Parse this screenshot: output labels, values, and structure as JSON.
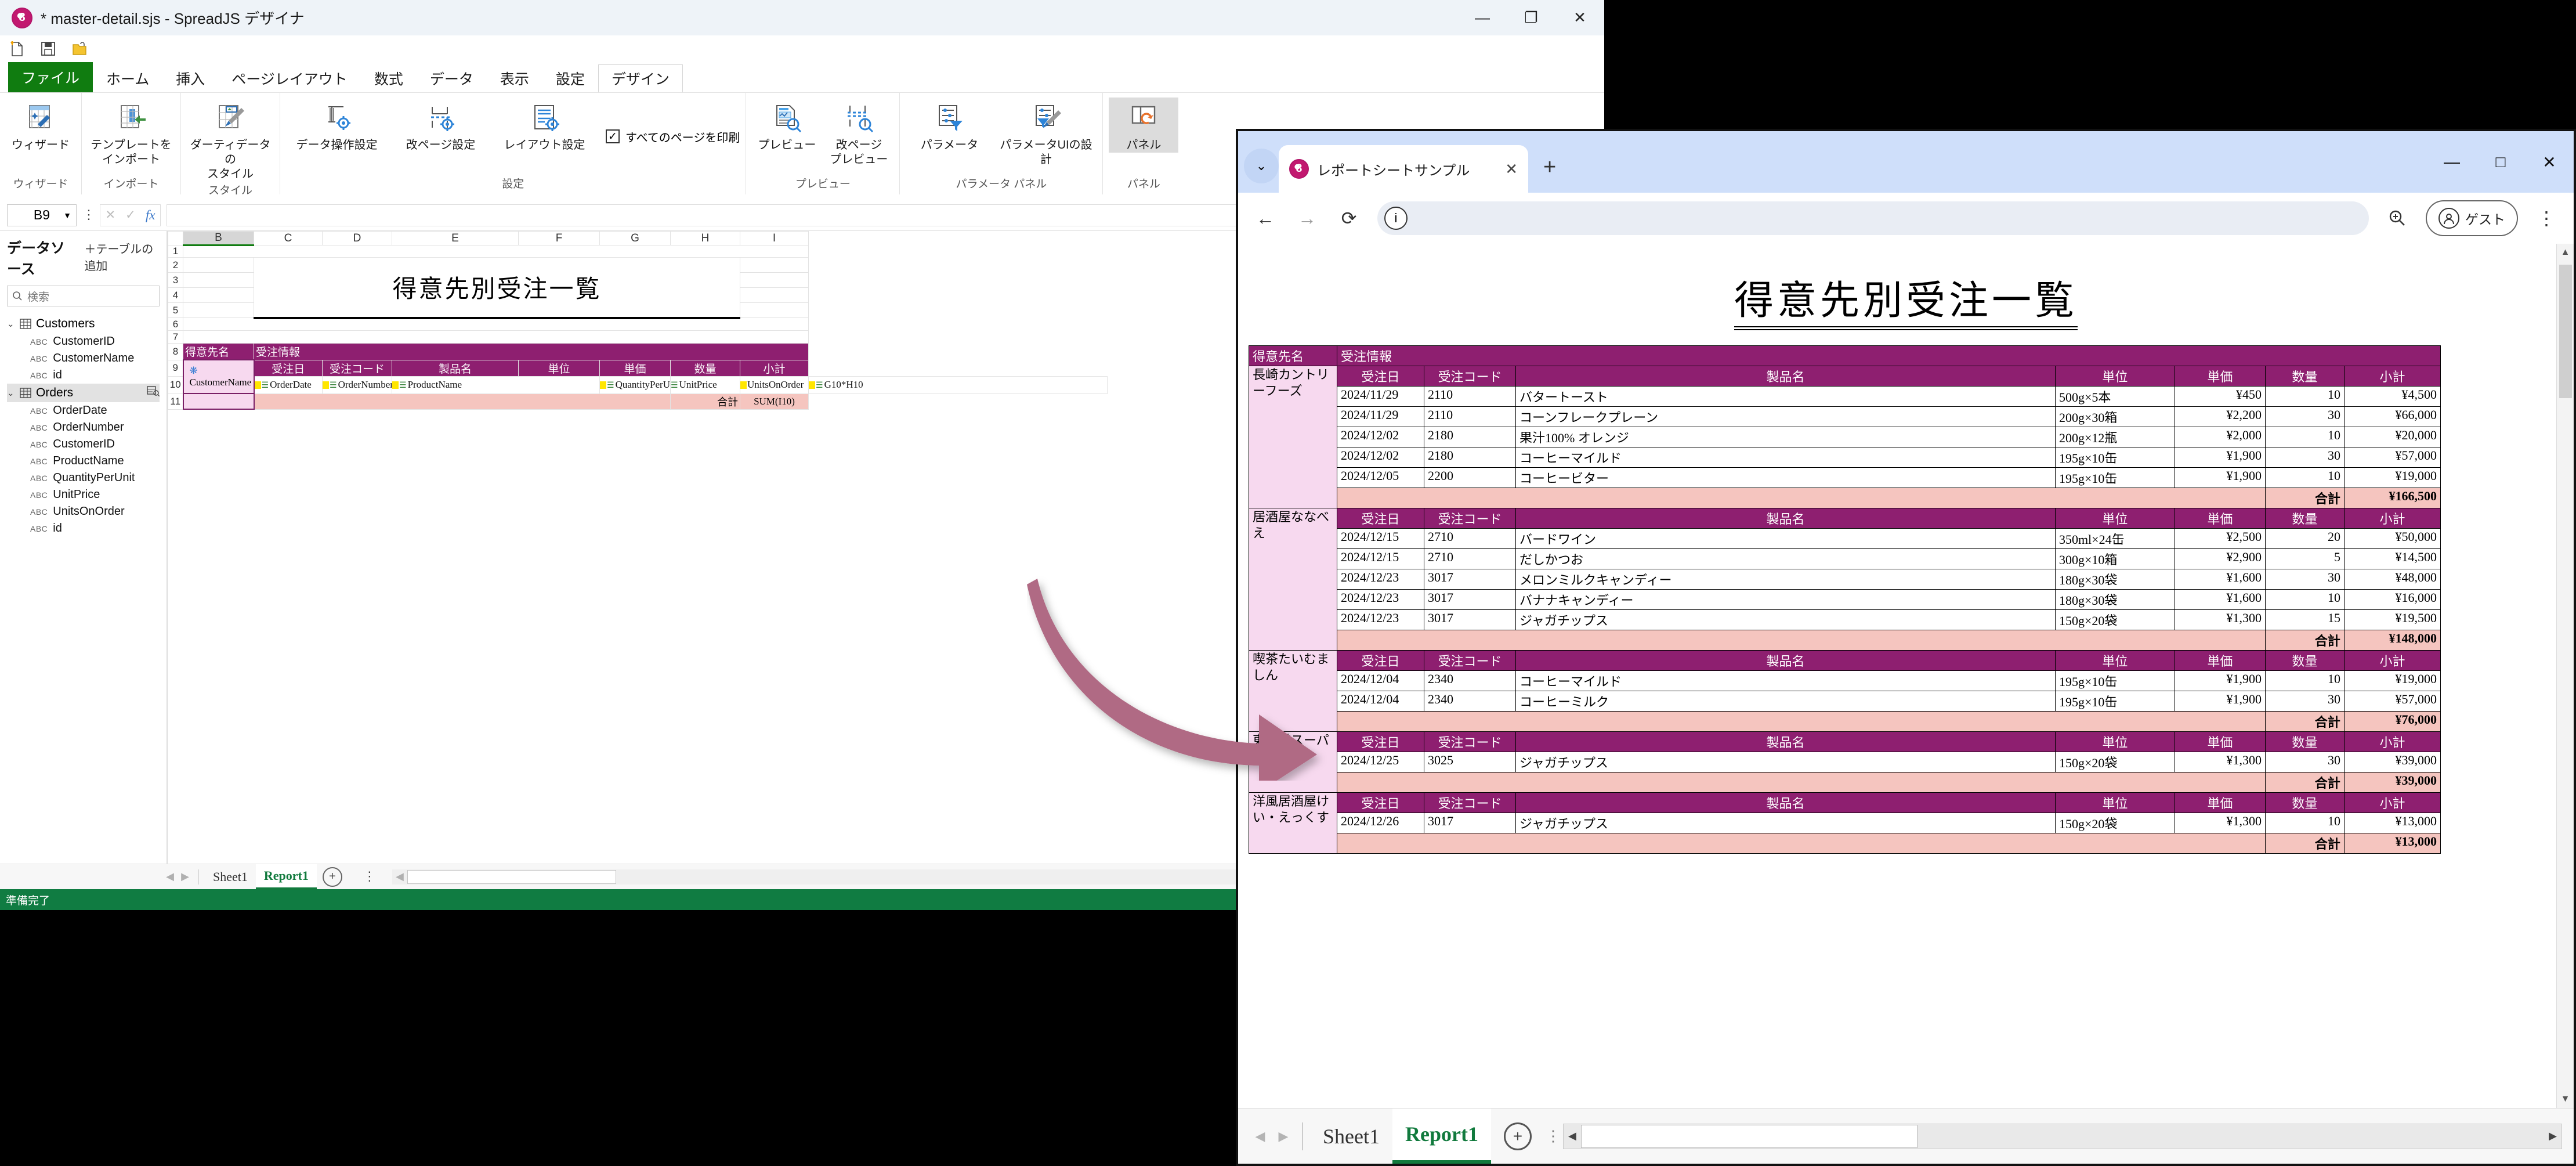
{
  "designer": {
    "title": "* master-detail.sjs - SpreadJS デザイナ",
    "logo_glyph": "8",
    "window_controls": {
      "minimize": "—",
      "maximize": "❐",
      "close": "✕"
    },
    "quick_access": [
      "new-file-icon",
      "save-icon",
      "open-folder-icon"
    ],
    "tabs": [
      {
        "label": "ファイル",
        "kind": "file"
      },
      {
        "label": "ホーム",
        "kind": "normal"
      },
      {
        "label": "挿入",
        "kind": "normal"
      },
      {
        "label": "ページレイアウト",
        "kind": "normal"
      },
      {
        "label": "数式",
        "kind": "normal"
      },
      {
        "label": "データ",
        "kind": "normal"
      },
      {
        "label": "表示",
        "kind": "normal"
      },
      {
        "label": "設定",
        "kind": "normal"
      },
      {
        "label": "デザイン",
        "kind": "active"
      }
    ],
    "ribbon_groups": [
      {
        "label": "ウィザード",
        "items": [
          {
            "label": "ウィザード",
            "icon": "wizard-icon"
          }
        ]
      },
      {
        "label": "インポート",
        "items": [
          {
            "label": "テンプレートを\nインポート",
            "icon": "import-template-icon"
          }
        ]
      },
      {
        "label": "スタイル",
        "items": [
          {
            "label": "ダーティデータの\nスタイル",
            "icon": "dirty-data-style-icon"
          }
        ]
      },
      {
        "label": "設定",
        "items": [
          {
            "label": "データ操作設定",
            "icon": "data-operation-settings-icon"
          },
          {
            "label": "改ページ設定",
            "icon": "page-break-settings-icon"
          },
          {
            "label": "レイアウト設定",
            "icon": "layout-settings-icon"
          }
        ],
        "checkbox": {
          "label": "すべてのページを印刷",
          "checked": true
        }
      },
      {
        "label": "プレビュー",
        "items": [
          {
            "label": "プレビュー",
            "icon": "preview-icon"
          },
          {
            "label": "改ページ\nプレビュー",
            "icon": "page-break-preview-icon"
          }
        ]
      },
      {
        "label": "パラメータ パネル",
        "items": [
          {
            "label": "パラメータ",
            "icon": "parameter-icon"
          },
          {
            "label": "パラメータUIの設計",
            "icon": "parameter-ui-design-icon"
          }
        ]
      },
      {
        "label": "パネル",
        "items": [
          {
            "label": "パネル",
            "icon": "panel-icon",
            "selected": true
          }
        ]
      }
    ],
    "formula_bar": {
      "name_box": "B9",
      "cancel_icon": "✕",
      "confirm_icon": "✓",
      "fx_label": "fx",
      "formula_value": ""
    },
    "datasource": {
      "title": "データソース",
      "add_table": "＋テーブルの追加",
      "search_placeholder": "検索",
      "tables": [
        {
          "name": "Customers",
          "highlighted": false,
          "fields": [
            "CustomerID",
            "CustomerName",
            "id"
          ]
        },
        {
          "name": "Orders",
          "highlighted": true,
          "fields": [
            "OrderDate",
            "OrderNumber",
            "CustomerID",
            "ProductName",
            "QuantityPerUnit",
            "UnitPrice",
            "UnitsOnOrder",
            "id"
          ]
        }
      ],
      "field_type_tag": "ABC"
    },
    "sheet": {
      "columns": [
        "B",
        "C",
        "D",
        "E",
        "F",
        "G",
        "H",
        "I"
      ],
      "selected_column": "B",
      "rows": [
        "1",
        "2",
        "3",
        "4",
        "5",
        "6",
        "7",
        "8",
        "9",
        "10",
        "11"
      ],
      "title_text": "得意先別受注一覧",
      "header_band": {
        "left": "得意先名",
        "right": "受注情報"
      },
      "column_headers": [
        "受注日",
        "受注コード",
        "製品名",
        "単位",
        "単価",
        "数量",
        "小計"
      ],
      "master_field": "CustomerName",
      "detail_fields": [
        "OrderDate",
        "OrderNumber",
        "ProductName",
        "QuantityPerUnit",
        "UnitPrice",
        "UnitsOnOrder",
        "G10*H10"
      ],
      "total_label": "合計",
      "total_formula": "SUM(I10)"
    },
    "sheet_tabs": {
      "tabs": [
        "Sheet1",
        "Report1"
      ],
      "active": "Report1",
      "add_label": "+"
    },
    "status": "準備完了"
  },
  "browser": {
    "tab_title": "レポートシートサンプル",
    "tab_close": "✕",
    "new_tab": "+",
    "window_controls": {
      "minimize": "—",
      "maximize": "□",
      "close": "✕"
    },
    "nav": {
      "back": "←",
      "forward": "→",
      "reload": "⟳",
      "info": "ⓘ"
    },
    "address_value": "",
    "zoom_icon": "zoom-icon",
    "profile_label": "ゲスト",
    "menu_icon": "⋮",
    "report": {
      "title": "得意先別受注一覧",
      "band_left": "得意先名",
      "band_right": "受注情報",
      "columns": [
        "受注日",
        "受注コード",
        "製品名",
        "単位",
        "単価",
        "数量",
        "小計"
      ],
      "total_label": "合計",
      "groups": [
        {
          "customer": "長崎カントリーフーズ",
          "rows": [
            {
              "date": "2024/11/29",
              "code": "2110",
              "product": "バタートースト",
              "unit": "500g×5本",
              "price": "¥450",
              "qty": "10",
              "subtotal": "¥4,500"
            },
            {
              "date": "2024/11/29",
              "code": "2110",
              "product": "コーンフレークプレーン",
              "unit": "200g×30箱",
              "price": "¥2,200",
              "qty": "30",
              "subtotal": "¥66,000"
            },
            {
              "date": "2024/12/02",
              "code": "2180",
              "product": "果汁100% オレンジ",
              "unit": "200g×12瓶",
              "price": "¥2,000",
              "qty": "10",
              "subtotal": "¥20,000"
            },
            {
              "date": "2024/12/02",
              "code": "2180",
              "product": "コーヒーマイルド",
              "unit": "195g×10缶",
              "price": "¥1,900",
              "qty": "30",
              "subtotal": "¥57,000"
            },
            {
              "date": "2024/12/05",
              "code": "2200",
              "product": "コーヒービター",
              "unit": "195g×10缶",
              "price": "¥1,900",
              "qty": "10",
              "subtotal": "¥19,000"
            }
          ],
          "total": "¥166,500"
        },
        {
          "customer": "居酒屋ななべえ",
          "rows": [
            {
              "date": "2024/12/15",
              "code": "2710",
              "product": "バードワイン",
              "unit": "350ml×24缶",
              "price": "¥2,500",
              "qty": "20",
              "subtotal": "¥50,000"
            },
            {
              "date": "2024/12/15",
              "code": "2710",
              "product": "だしかつお",
              "unit": "300g×10箱",
              "price": "¥2,900",
              "qty": "5",
              "subtotal": "¥14,500"
            },
            {
              "date": "2024/12/23",
              "code": "3017",
              "product": "メロンミルクキャンディー",
              "unit": "180g×30袋",
              "price": "¥1,600",
              "qty": "30",
              "subtotal": "¥48,000"
            },
            {
              "date": "2024/12/23",
              "code": "3017",
              "product": "バナナキャンディー",
              "unit": "180g×30袋",
              "price": "¥1,600",
              "qty": "10",
              "subtotal": "¥16,000"
            },
            {
              "date": "2024/12/23",
              "code": "3017",
              "product": "ジャガチップス",
              "unit": "150g×20袋",
              "price": "¥1,300",
              "qty": "15",
              "subtotal": "¥19,500"
            }
          ],
          "total": "¥148,000"
        },
        {
          "customer": "喫茶たいむましん",
          "rows": [
            {
              "date": "2024/12/04",
              "code": "2340",
              "product": "コーヒーマイルド",
              "unit": "195g×10缶",
              "price": "¥1,900",
              "qty": "10",
              "subtotal": "¥19,000"
            },
            {
              "date": "2024/12/04",
              "code": "2340",
              "product": "コーヒーミルク",
              "unit": "195g×10缶",
              "price": "¥1,900",
              "qty": "30",
              "subtotal": "¥57,000"
            }
          ],
          "total": "¥76,000"
        },
        {
          "customer": "東海道スーパー",
          "rows": [
            {
              "date": "2024/12/25",
              "code": "3025",
              "product": "ジャガチップス",
              "unit": "150g×20袋",
              "price": "¥1,300",
              "qty": "30",
              "subtotal": "¥39,000"
            }
          ],
          "total": "¥39,000"
        },
        {
          "customer": "洋風居酒屋けい・えっくす",
          "rows": [
            {
              "date": "2024/12/26",
              "code": "3017",
              "product": "ジャガチップス",
              "unit": "150g×20袋",
              "price": "¥1,300",
              "qty": "10",
              "subtotal": "¥13,000"
            }
          ],
          "total": "¥13,000"
        }
      ]
    },
    "sheet_tabs": {
      "tabs": [
        "Sheet1",
        "Report1"
      ],
      "active": "Report1",
      "add_label": "+"
    }
  },
  "annotation": {
    "arrow_color": "#b06b84"
  },
  "colors": {
    "header_purple": "#8e1f70",
    "customer_pink": "#f7d9ef",
    "total_pink": "#f5c5bf",
    "file_tab_green": "#107c10",
    "status_green": "#107c42"
  }
}
